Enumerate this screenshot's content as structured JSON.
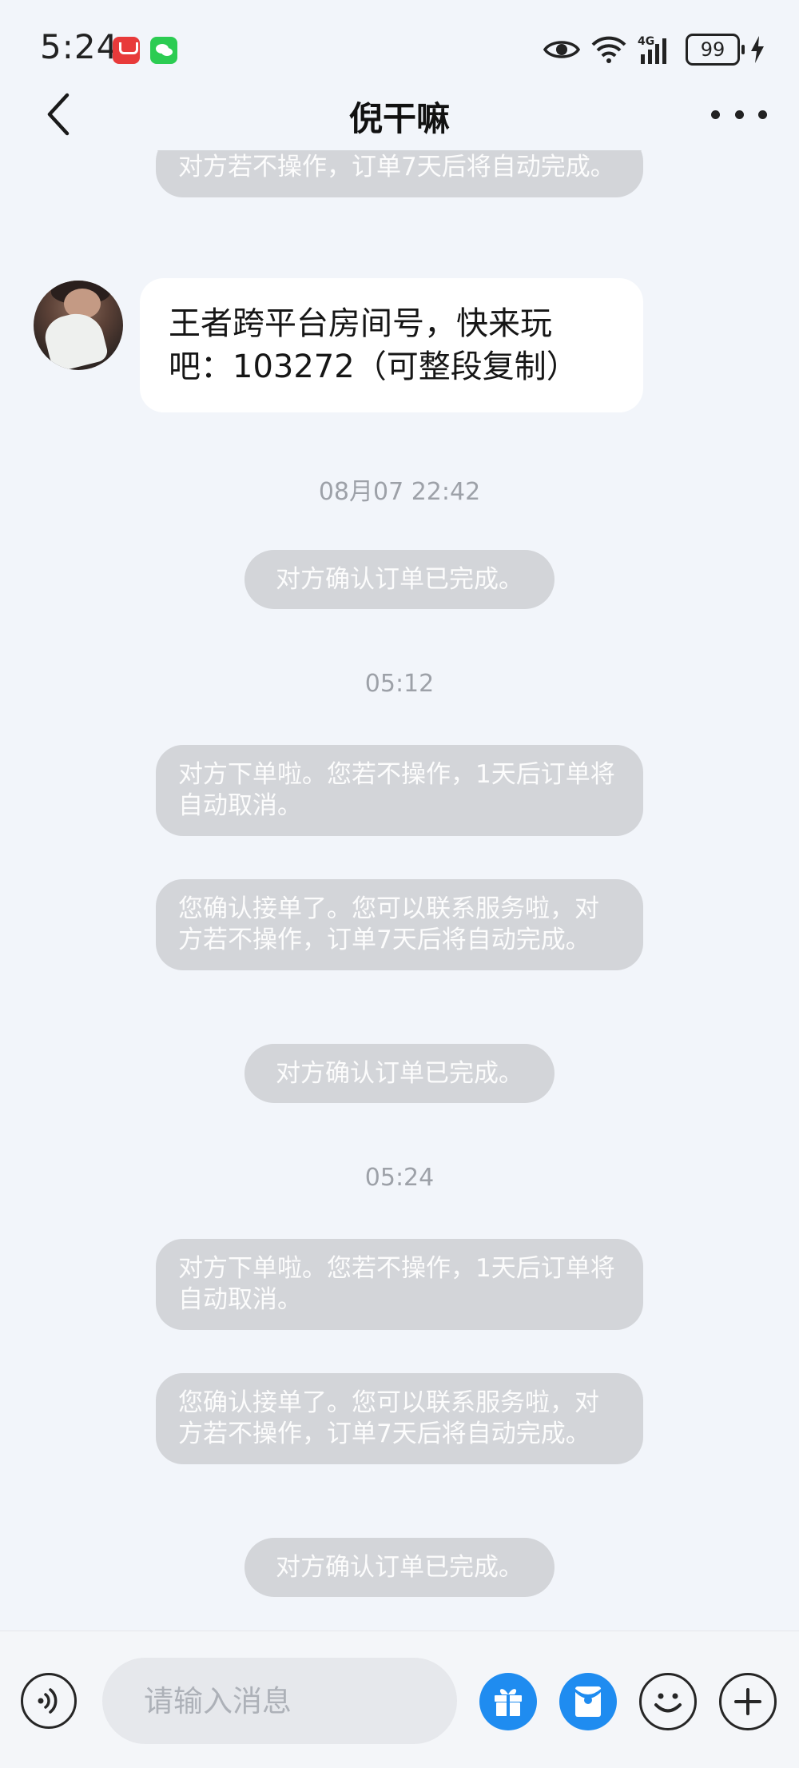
{
  "status_bar": {
    "time": "5:24",
    "network": "4G",
    "battery": "99"
  },
  "header": {
    "title": "倪干嘛"
  },
  "messages": {
    "top_partial": "对方若不操作，订单7天后将自动完成。",
    "user_message": "王者跨平台房间号，快来玩吧：103272（可整段复制）",
    "ts1": "08月07 22:42",
    "confirm1": "对方确认订单已完成。",
    "ts2": "05:12",
    "order1": "对方下单啦。您若不操作，1天后订单将自动取消。",
    "accepted1": "您确认接单了。您可以联系服务啦，对方若不操作，订单7天后将自动完成。",
    "confirm2": "对方确认订单已完成。",
    "ts3": "05:24",
    "order2": "对方下单啦。您若不操作，1天后订单将自动取消。",
    "accepted2": "您确认接单了。您可以联系服务啦，对方若不操作，订单7天后将自动完成。",
    "confirm3": "对方确认订单已完成。"
  },
  "input": {
    "placeholder": "请输入消息"
  },
  "colors": {
    "accent": "#1f8cf0",
    "background": "#f2f5fa",
    "system_bubble": "#d3d5d9"
  },
  "icons": [
    "back-icon",
    "more-icon",
    "eye-icon",
    "wifi-icon",
    "signal-icon",
    "battery-icon",
    "charging-icon",
    "voice-icon",
    "gift-icon",
    "red-packet-icon",
    "emoji-icon",
    "plus-icon"
  ]
}
